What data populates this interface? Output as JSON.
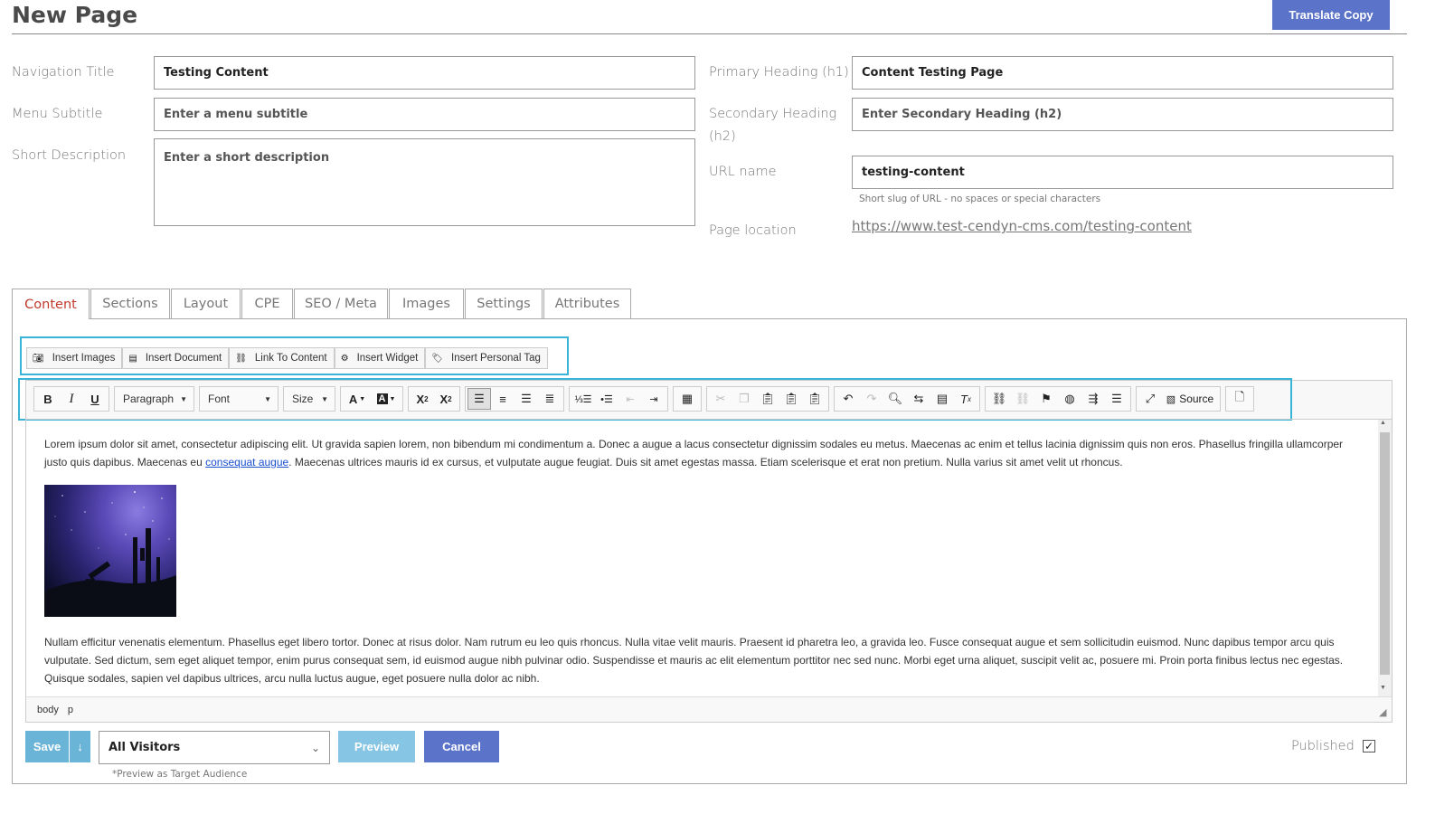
{
  "header": {
    "title": "New Page",
    "translate_label": "Translate Copy"
  },
  "form_left": {
    "nav_title_label": "Navigation Title",
    "nav_title_value": "Testing Content",
    "menu_subtitle_label": "Menu Subtitle",
    "menu_subtitle_placeholder": "Enter a menu subtitle",
    "short_desc_label": "Short Description",
    "short_desc_placeholder": "Enter a short description"
  },
  "form_right": {
    "h1_label": "Primary Heading (h1)",
    "h1_value": "Content Testing Page",
    "h2_label_line1": "Secondary Heading",
    "h2_label_line2": "(h2)",
    "h2_placeholder": "Enter Secondary Heading (h2)",
    "url_label": "URL name",
    "url_value": "testing-content",
    "url_hint": "Short slug of URL - no spaces or special characters",
    "location_label": "Page location",
    "location_url": "https://www.test-cendyn-cms.com/testing-content"
  },
  "tabs": [
    "Content",
    "Sections",
    "Layout",
    "CPE",
    "SEO / Meta",
    "Images",
    "Settings",
    "Attributes"
  ],
  "insert_buttons": [
    {
      "label": "Insert Images",
      "icon": "camera-icon"
    },
    {
      "label": "Insert Document",
      "icon": "document-icon"
    },
    {
      "label": "Link To Content",
      "icon": "link-icon"
    },
    {
      "label": "Insert Widget",
      "icon": "gear-icon"
    },
    {
      "label": "Insert Personal Tag",
      "icon": "tag-icon"
    }
  ],
  "toolbar": {
    "paragraph": "Paragraph",
    "font": "Font",
    "size": "Size",
    "source": "Source"
  },
  "editor": {
    "para1_a": "Lorem ipsum dolor sit amet, consectetur adipiscing elit. Ut gravida sapien lorem, non bibendum mi condimentum a. Donec a augue a lacus consectetur dignissim sodales eu metus. Maecenas ac enim et tellus lacinia dignissim quis non eros. Phasellus fringilla ullamcorper justo quis dapibus. Maecenas eu ",
    "para1_link": "consequat augue",
    "para1_b": ". Maecenas ultrices mauris id ex cursus, et vulputate augue feugiat. Duis sit amet egestas massa. Etiam scelerisque et erat non pretium. Nulla varius sit amet velit ut rhoncus.",
    "para2": "Nullam efficitur venenatis elementum. Phasellus eget libero tortor. Donec at risus dolor. Nam rutrum eu leo quis rhoncus. Nulla vitae velit mauris. Praesent id pharetra leo, a gravida leo. Fusce consequat augue et sem sollicitudin euismod. Nunc dapibus tempor arcu quis vulputate. Sed dictum, sem eget aliquet tempor, enim purus consequat sem, id euismod augue nibh pulvinar odio. Suspendisse et mauris ac elit elementum porttitor nec sed nunc. Morbi eget urna aliquet, suscipit velit ac, posuere mi. Proin porta finibus lectus nec egestas. Quisque sodales, sapien vel dapibus ultrices, arcu nulla luctus augue, eget posuere nulla dolor ac nibh.",
    "path": [
      "body",
      "p"
    ]
  },
  "footer": {
    "save": "Save",
    "save_arrow": "↓",
    "audience": "All Visitors",
    "audience_hint": "*Preview as Target Audience",
    "preview": "Preview",
    "cancel": "Cancel",
    "published_label": "Published",
    "published_checked": true
  },
  "colors": {
    "primary": "#5b74c9",
    "save": "#6ab4d8",
    "highlight": "#38b5d6",
    "active_tab": "#c0392b"
  }
}
